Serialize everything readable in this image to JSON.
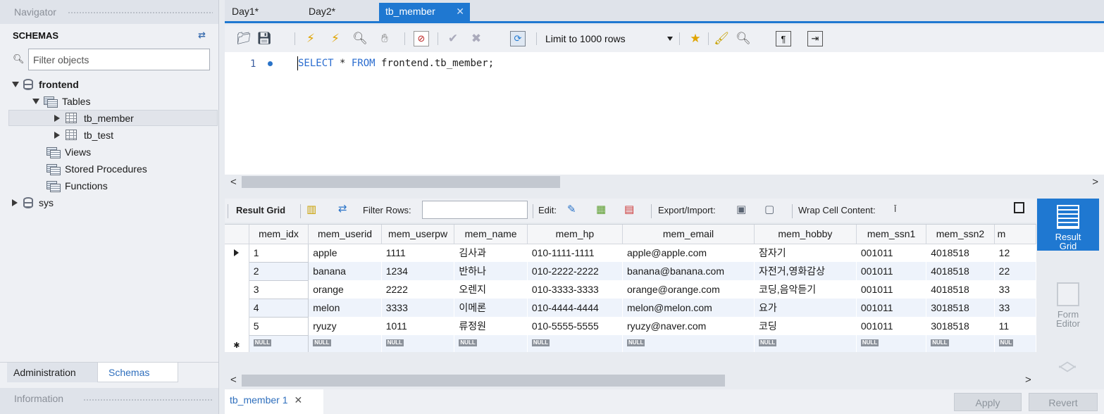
{
  "navigator": {
    "title": "Navigator",
    "schemas_label": "SCHEMAS",
    "filter_placeholder": "Filter objects",
    "tree": {
      "db1": "frontend",
      "tables": "Tables",
      "table1": "tb_member",
      "table2": "tb_test",
      "views": "Views",
      "procs": "Stored Procedures",
      "funcs": "Functions",
      "db2": "sys"
    },
    "tabs": {
      "admin": "Administration",
      "schemas": "Schemas"
    },
    "info": "Information"
  },
  "tabs": [
    "Day1*",
    "Day2*",
    "tb_member"
  ],
  "toolbar": {
    "limit": "Limit to 1000 rows"
  },
  "editor": {
    "line_number": "1",
    "sql": {
      "kw1": "SELECT",
      "star": " * ",
      "kw2": "FROM",
      "rest": " frontend.tb_member;"
    }
  },
  "result_toolbar": {
    "result_grid": "Result Grid",
    "filter_rows": "Filter Rows:",
    "edit": "Edit:",
    "export_import": "Export/Import:",
    "wrap": "Wrap Cell Content:"
  },
  "grid": {
    "columns": [
      "mem_idx",
      "mem_userid",
      "mem_userpw",
      "mem_name",
      "mem_hp",
      "mem_email",
      "mem_hobby",
      "mem_ssn1",
      "mem_ssn2",
      "m"
    ],
    "rows": [
      [
        "1",
        "apple",
        "1111",
        "김사과",
        "010-1111-1111",
        "apple@apple.com",
        "잠자기",
        "001011",
        "4018518",
        "12"
      ],
      [
        "2",
        "banana",
        "1234",
        "반하나",
        "010-2222-2222",
        "banana@banana.com",
        "자전거,영화감상",
        "001011",
        "4018518",
        "22"
      ],
      [
        "3",
        "orange",
        "2222",
        "오렌지",
        "010-3333-3333",
        "orange@orange.com",
        "코딩,음악듣기",
        "001011",
        "4018518",
        "33"
      ],
      [
        "4",
        "melon",
        "3333",
        "이메론",
        "010-4444-4444",
        "melon@melon.com",
        "요가",
        "001011",
        "3018518",
        "33"
      ],
      [
        "5",
        "ryuzy",
        "1011",
        "류정원",
        "010-5555-5555",
        "ryuzy@naver.com",
        "코딩",
        "001011",
        "3018518",
        "11"
      ]
    ],
    "null_label": "NULL",
    "null_last": "NUL"
  },
  "side_panel": {
    "result_grid_line1": "Result",
    "result_grid_line2": "Grid",
    "form_line1": "Form",
    "form_line2": "Editor"
  },
  "bottom": {
    "result_tab": "tb_member 1",
    "apply": "Apply",
    "revert": "Revert"
  },
  "colors": {
    "accent": "#1f78d1",
    "keyword": "#2a6ccf",
    "row_alt": "#eef3fb"
  }
}
